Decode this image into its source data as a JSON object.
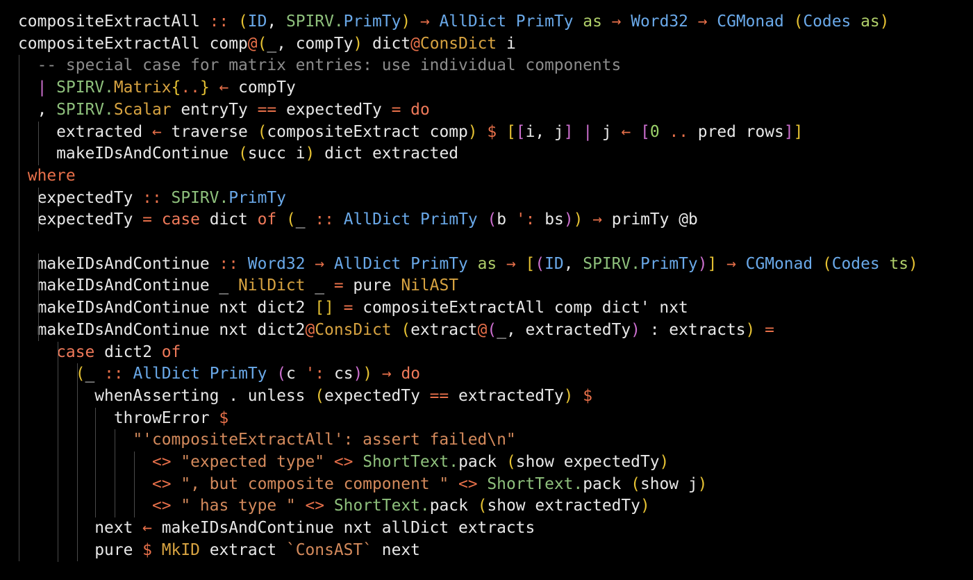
{
  "editor": {
    "language": "Haskell",
    "theme": {
      "background": "#000000",
      "default": "#e8e8e8",
      "comment": "#8c8c8c",
      "keyword": "#e8704a",
      "keyword2": "#f07a5a",
      "operator": "#e8704a",
      "type": "#6aa9e9",
      "module": "#8ec07c",
      "constructor": "#d7a341",
      "string": "#d48a5c",
      "paren": "#e6c233",
      "bracket_outer": "#e6c233",
      "bracket_inner": "#cc6fcf",
      "number": "#9cd36a",
      "tyvar": "#b0cf6a",
      "pipe": "#cc6fcf",
      "indent_guide": "#4a4a4a"
    },
    "lines": [
      [
        [
          "compositeExtractAll",
          "default"
        ],
        [
          " :: ",
          "operator"
        ],
        [
          "(",
          "paren"
        ],
        [
          "ID",
          "type"
        ],
        [
          ", ",
          "default"
        ],
        [
          "SPIRV.",
          "module"
        ],
        [
          "PrimTy",
          "type"
        ],
        [
          ")",
          "paren"
        ],
        [
          " → ",
          "operator"
        ],
        [
          "AllDict",
          "type"
        ],
        [
          " ",
          "default"
        ],
        [
          "PrimTy",
          "type"
        ],
        [
          " as",
          "tyvar"
        ],
        [
          " → ",
          "operator"
        ],
        [
          "Word32",
          "type"
        ],
        [
          " → ",
          "operator"
        ],
        [
          "CGMonad",
          "type"
        ],
        [
          " ",
          "default"
        ],
        [
          "(",
          "paren"
        ],
        [
          "Codes",
          "type"
        ],
        [
          " as",
          "tyvar"
        ],
        [
          ")",
          "paren"
        ]
      ],
      [
        [
          "compositeExtractAll comp",
          "default"
        ],
        [
          "@",
          "operator"
        ],
        [
          "(",
          "paren"
        ],
        [
          "_, compTy",
          "default"
        ],
        [
          ")",
          "paren"
        ],
        [
          " dict",
          "default"
        ],
        [
          "@",
          "operator"
        ],
        [
          "ConsDict",
          "constructor"
        ],
        [
          " i",
          "default"
        ]
      ],
      [
        [
          "  -- special case for matrix entries: use individual components",
          "comment"
        ]
      ],
      [
        [
          "  ",
          "default"
        ],
        [
          "|",
          "pipe"
        ],
        [
          " ",
          "default"
        ],
        [
          "SPIRV.",
          "module"
        ],
        [
          "Matrix",
          "constructor"
        ],
        [
          "{",
          "paren"
        ],
        [
          "..",
          "operator"
        ],
        [
          "}",
          "paren"
        ],
        [
          " ← ",
          "operator"
        ],
        [
          "compTy",
          "default"
        ]
      ],
      [
        [
          "  , ",
          "default"
        ],
        [
          "SPIRV.",
          "module"
        ],
        [
          "Scalar",
          "constructor"
        ],
        [
          " entryTy ",
          "default"
        ],
        [
          "==",
          "operator"
        ],
        [
          " expectedTy ",
          "default"
        ],
        [
          "=",
          "operator"
        ],
        [
          " ",
          "default"
        ],
        [
          "do",
          "keyword2"
        ]
      ],
      [
        [
          "    extracted ",
          "default"
        ],
        [
          "←",
          "operator"
        ],
        [
          " traverse ",
          "default"
        ],
        [
          "(",
          "paren"
        ],
        [
          "compositeExtract comp",
          "default"
        ],
        [
          ")",
          "paren"
        ],
        [
          " ",
          "default"
        ],
        [
          "$",
          "operator"
        ],
        [
          " ",
          "default"
        ],
        [
          "[",
          "bracket_outer"
        ],
        [
          "[",
          "bracket_inner"
        ],
        [
          "i, j",
          "default"
        ],
        [
          "]",
          "bracket_inner"
        ],
        [
          " ",
          "default"
        ],
        [
          "|",
          "pipe"
        ],
        [
          " j ",
          "default"
        ],
        [
          "←",
          "operator"
        ],
        [
          " ",
          "default"
        ],
        [
          "[",
          "bracket_inner"
        ],
        [
          "0",
          "number"
        ],
        [
          " .. ",
          "operator"
        ],
        [
          "pred rows",
          "default"
        ],
        [
          "]",
          "bracket_inner"
        ],
        [
          "]",
          "bracket_outer"
        ]
      ],
      [
        [
          "    makeIDsAndContinue ",
          "default"
        ],
        [
          "(",
          "paren"
        ],
        [
          "succ i",
          "default"
        ],
        [
          ")",
          "paren"
        ],
        [
          " dict extracted",
          "default"
        ]
      ],
      [
        [
          " where",
          "keyword"
        ]
      ],
      [
        [
          "  expectedTy",
          "default"
        ],
        [
          " :: ",
          "operator"
        ],
        [
          "SPIRV.",
          "module"
        ],
        [
          "PrimTy",
          "type"
        ]
      ],
      [
        [
          "  expectedTy ",
          "default"
        ],
        [
          "=",
          "operator"
        ],
        [
          " ",
          "default"
        ],
        [
          "case",
          "keyword2"
        ],
        [
          " dict ",
          "default"
        ],
        [
          "of",
          "keyword2"
        ],
        [
          " ",
          "default"
        ],
        [
          "(",
          "paren"
        ],
        [
          "_",
          "default"
        ],
        [
          " :: ",
          "operator"
        ],
        [
          "AllDict",
          "type"
        ],
        [
          " ",
          "default"
        ],
        [
          "PrimTy",
          "type"
        ],
        [
          " ",
          "default"
        ],
        [
          "(",
          "bracket_inner"
        ],
        [
          "b ",
          "default"
        ],
        [
          "':",
          "operator"
        ],
        [
          " bs",
          "default"
        ],
        [
          ")",
          "bracket_inner"
        ],
        [
          ")",
          "paren"
        ],
        [
          " → ",
          "operator"
        ],
        [
          "primTy ",
          "default"
        ],
        [
          "@",
          "default"
        ],
        [
          "b",
          "default"
        ]
      ],
      [
        [
          "",
          "default"
        ]
      ],
      [
        [
          "  makeIDsAndContinue",
          "default"
        ],
        [
          " :: ",
          "operator"
        ],
        [
          "Word32",
          "type"
        ],
        [
          " → ",
          "operator"
        ],
        [
          "AllDict",
          "type"
        ],
        [
          " ",
          "default"
        ],
        [
          "PrimTy",
          "type"
        ],
        [
          " as",
          "tyvar"
        ],
        [
          " → ",
          "operator"
        ],
        [
          "[",
          "paren"
        ],
        [
          "(",
          "bracket_inner"
        ],
        [
          "ID",
          "type"
        ],
        [
          ", ",
          "default"
        ],
        [
          "SPIRV.",
          "module"
        ],
        [
          "PrimTy",
          "type"
        ],
        [
          ")",
          "bracket_inner"
        ],
        [
          "]",
          "paren"
        ],
        [
          " → ",
          "operator"
        ],
        [
          "CGMonad",
          "type"
        ],
        [
          " ",
          "default"
        ],
        [
          "(",
          "paren"
        ],
        [
          "Codes",
          "type"
        ],
        [
          " ts",
          "tyvar"
        ],
        [
          ")",
          "paren"
        ]
      ],
      [
        [
          "  makeIDsAndContinue _ ",
          "default"
        ],
        [
          "NilDict",
          "constructor"
        ],
        [
          " _ ",
          "default"
        ],
        [
          "=",
          "operator"
        ],
        [
          " pure ",
          "default"
        ],
        [
          "NilAST",
          "constructor"
        ]
      ],
      [
        [
          "  makeIDsAndContinue nxt dict2 ",
          "default"
        ],
        [
          "[]",
          "paren"
        ],
        [
          " ",
          "default"
        ],
        [
          "=",
          "operator"
        ],
        [
          " compositeExtractAll comp dict' nxt",
          "default"
        ]
      ],
      [
        [
          "  makeIDsAndContinue nxt dict2",
          "default"
        ],
        [
          "@",
          "operator"
        ],
        [
          "ConsDict",
          "constructor"
        ],
        [
          " ",
          "default"
        ],
        [
          "(",
          "paren"
        ],
        [
          "extract",
          "default"
        ],
        [
          "@",
          "operator"
        ],
        [
          "(",
          "bracket_inner"
        ],
        [
          "_, extractedTy",
          "default"
        ],
        [
          ")",
          "bracket_inner"
        ],
        [
          " : extracts",
          "default"
        ],
        [
          ")",
          "paren"
        ],
        [
          " ",
          "default"
        ],
        [
          "=",
          "operator"
        ]
      ],
      [
        [
          "    ",
          "default"
        ],
        [
          "case",
          "keyword2"
        ],
        [
          " dict2 ",
          "default"
        ],
        [
          "of",
          "keyword2"
        ]
      ],
      [
        [
          "      ",
          "default"
        ],
        [
          "(",
          "paren"
        ],
        [
          "_",
          "default"
        ],
        [
          " :: ",
          "operator"
        ],
        [
          "AllDict",
          "type"
        ],
        [
          " ",
          "default"
        ],
        [
          "PrimTy",
          "type"
        ],
        [
          " ",
          "default"
        ],
        [
          "(",
          "bracket_inner"
        ],
        [
          "c ",
          "default"
        ],
        [
          "':",
          "operator"
        ],
        [
          " cs",
          "default"
        ],
        [
          ")",
          "bracket_inner"
        ],
        [
          ")",
          "paren"
        ],
        [
          " → ",
          "operator"
        ],
        [
          "do",
          "keyword2"
        ]
      ],
      [
        [
          "        whenAsserting . unless ",
          "default"
        ],
        [
          "(",
          "paren"
        ],
        [
          "expectedTy ",
          "default"
        ],
        [
          "==",
          "operator"
        ],
        [
          " extractedTy",
          "default"
        ],
        [
          ")",
          "paren"
        ],
        [
          " ",
          "default"
        ],
        [
          "$",
          "operator"
        ]
      ],
      [
        [
          "          throwError ",
          "default"
        ],
        [
          "$",
          "operator"
        ]
      ],
      [
        [
          "            \"'compositeExtractAll': assert failed\\n\"",
          "string"
        ]
      ],
      [
        [
          "              ",
          "default"
        ],
        [
          "<>",
          "operator"
        ],
        [
          " ",
          "default"
        ],
        [
          "\"expected type\"",
          "string"
        ],
        [
          " ",
          "default"
        ],
        [
          "<>",
          "operator"
        ],
        [
          " ",
          "default"
        ],
        [
          "ShortText.",
          "module"
        ],
        [
          "pack ",
          "default"
        ],
        [
          "(",
          "paren"
        ],
        [
          "show expectedTy",
          "default"
        ],
        [
          ")",
          "paren"
        ]
      ],
      [
        [
          "              ",
          "default"
        ],
        [
          "<>",
          "operator"
        ],
        [
          " ",
          "default"
        ],
        [
          "\", but composite component \"",
          "string"
        ],
        [
          " ",
          "default"
        ],
        [
          "<>",
          "operator"
        ],
        [
          " ",
          "default"
        ],
        [
          "ShortText.",
          "module"
        ],
        [
          "pack ",
          "default"
        ],
        [
          "(",
          "paren"
        ],
        [
          "show j",
          "default"
        ],
        [
          ")",
          "paren"
        ]
      ],
      [
        [
          "              ",
          "default"
        ],
        [
          "<>",
          "operator"
        ],
        [
          " ",
          "default"
        ],
        [
          "\" has type \"",
          "string"
        ],
        [
          " ",
          "default"
        ],
        [
          "<>",
          "operator"
        ],
        [
          " ",
          "default"
        ],
        [
          "ShortText.",
          "module"
        ],
        [
          "pack ",
          "default"
        ],
        [
          "(",
          "paren"
        ],
        [
          "show extractedTy",
          "default"
        ],
        [
          ")",
          "paren"
        ]
      ],
      [
        [
          "        next ",
          "default"
        ],
        [
          "←",
          "operator"
        ],
        [
          " makeIDsAndContinue nxt allDict extracts",
          "default"
        ]
      ],
      [
        [
          "        pure ",
          "default"
        ],
        [
          "$",
          "operator"
        ],
        [
          " ",
          "default"
        ],
        [
          "MkID",
          "constructor"
        ],
        [
          " extract ",
          "default"
        ],
        [
          "`ConsAST`",
          "string"
        ],
        [
          " next",
          "default"
        ]
      ]
    ]
  }
}
